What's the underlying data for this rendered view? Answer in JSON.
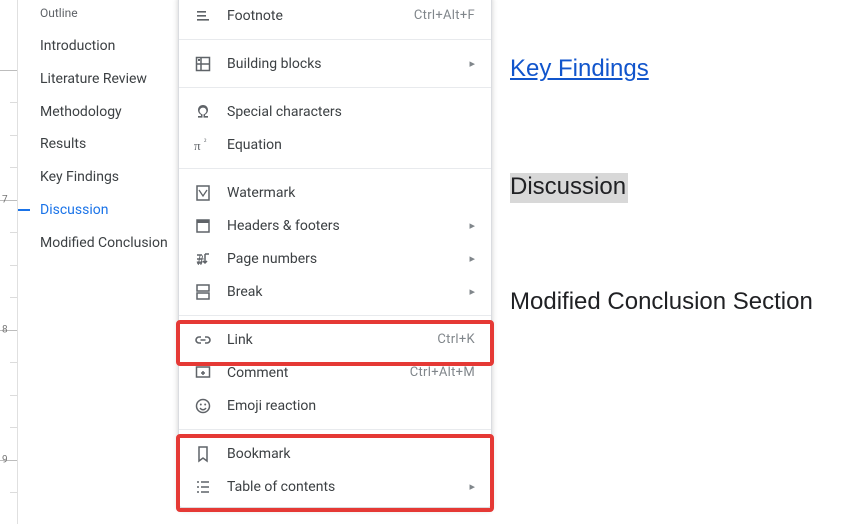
{
  "outline": {
    "title": "Outline",
    "items": [
      {
        "label": "Introduction",
        "active": false
      },
      {
        "label": "Literature Review",
        "active": false
      },
      {
        "label": "Methodology",
        "active": false
      },
      {
        "label": "Results",
        "active": false
      },
      {
        "label": "Key Findings",
        "active": false
      },
      {
        "label": "Discussion",
        "active": true
      },
      {
        "label": "Modified Conclusion",
        "active": false
      }
    ]
  },
  "menu": {
    "items": [
      {
        "icon": "footnote-icon",
        "label": "Footnote",
        "shortcut": "Ctrl+Alt+F",
        "sub": false
      },
      {
        "sep": true
      },
      {
        "icon": "building-blocks-icon",
        "label": "Building blocks",
        "shortcut": "",
        "sub": true
      },
      {
        "sep": true
      },
      {
        "icon": "omega-icon",
        "label": "Special characters",
        "shortcut": "",
        "sub": false
      },
      {
        "icon": "pi-icon",
        "label": "Equation",
        "shortcut": "",
        "sub": false
      },
      {
        "sep": true
      },
      {
        "icon": "watermark-icon",
        "label": "Watermark",
        "shortcut": "",
        "sub": false
      },
      {
        "icon": "headers-footers-icon",
        "label": "Headers & footers",
        "shortcut": "",
        "sub": true
      },
      {
        "icon": "page-numbers-icon",
        "label": "Page numbers",
        "shortcut": "",
        "sub": true
      },
      {
        "icon": "break-icon",
        "label": "Break",
        "shortcut": "",
        "sub": true
      },
      {
        "sep": true
      },
      {
        "icon": "link-icon",
        "label": "Link",
        "shortcut": "Ctrl+K",
        "sub": false
      },
      {
        "icon": "comment-icon",
        "label": "Comment",
        "shortcut": "Ctrl+Alt+M",
        "sub": false
      },
      {
        "icon": "emoji-icon",
        "label": "Emoji reaction",
        "shortcut": "",
        "sub": false
      },
      {
        "sep": true
      },
      {
        "icon": "bookmark-icon",
        "label": "Bookmark",
        "shortcut": "",
        "sub": false
      },
      {
        "icon": "toc-icon",
        "label": "Table of contents",
        "shortcut": "",
        "sub": true
      }
    ]
  },
  "document": {
    "link_text": "Key Findings",
    "selected_heading": "Discussion",
    "next_heading": "Modified Conclusion Section"
  },
  "ruler": {
    "labels": [
      "7",
      "8",
      "9"
    ]
  }
}
